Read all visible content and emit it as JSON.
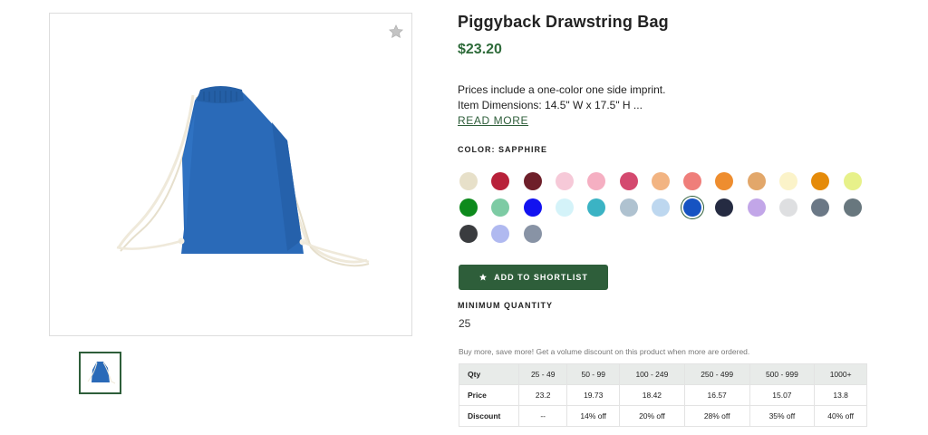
{
  "product": {
    "title": "Piggyback Drawstring Bag",
    "price": "$23.20",
    "description_line1": "Prices include a one-color one side imprint.",
    "description_line2": "Item Dimensions: 14.5\" W x 17.5\" H ...",
    "read_more": "READ MORE",
    "color_label": "COLOR: SAPPHIRE"
  },
  "colors": {
    "accent": "#2e5e3a",
    "price": "#2e6b3a",
    "bag": "#2a6ab8",
    "swatches": [
      "#e7e0c9",
      "#b8213a",
      "#6e1f2a",
      "#f6c9d8",
      "#f5afc2",
      "#d4496f",
      "#f2b482",
      "#ef7e7a",
      "#ee8d2f",
      "#e2a76a",
      "#fbf3c9",
      "#e58b0a",
      "#e7f18a",
      "#0d8a1c",
      "#7dcba4",
      "#1212f0",
      "#d4f3f9",
      "#3bb3c4",
      "#afc2d0",
      "#bdd7ef",
      "#1653c2",
      "#252b42",
      "#c2a6e8",
      "#dedfe1",
      "#6b7886",
      "#68777e",
      "#3a3c3f",
      "#b0b9f0",
      "#8893a5"
    ],
    "selected_index": 20
  },
  "actions": {
    "shortlist_label": "ADD TO SHORTLIST"
  },
  "quantity": {
    "label": "MINIMUM QUANTITY",
    "value": "25"
  },
  "pricing": {
    "note": "Buy more, save more! Get a volume discount on this product when more are ordered.",
    "rows": [
      [
        "Qty",
        "25 - 49",
        "50 - 99",
        "100 - 249",
        "250 - 499",
        "500 - 999",
        "1000+"
      ],
      [
        "Price",
        "23.2",
        "19.73",
        "18.42",
        "16.57",
        "15.07",
        "13.8"
      ],
      [
        "Discount",
        "--",
        "14% off",
        "20% off",
        "28% off",
        "35% off",
        "40% off"
      ]
    ]
  },
  "icons": {
    "favorite": "star-icon",
    "shortlist": "star-icon"
  }
}
